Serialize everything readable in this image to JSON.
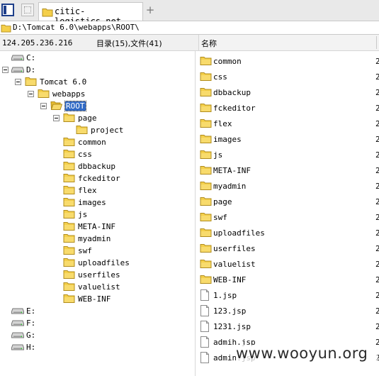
{
  "tabs": {
    "active_label": "citic-logistics.net",
    "new_tab": "+"
  },
  "path": "D:\\Tomcat 6.0\\webapps\\ROOT\\",
  "info": {
    "ip": "124.205.236.216",
    "counts": "目录(15),文件(41)"
  },
  "columns": {
    "name": "名称"
  },
  "tree": [
    {
      "name": "drive-c",
      "label": "C:",
      "level": 0,
      "icon": "drive",
      "expander": false
    },
    {
      "name": "drive-d",
      "label": "D:",
      "level": 0,
      "icon": "drive",
      "expander": true
    },
    {
      "name": "tomcat",
      "label": "Tomcat 6.0",
      "level": 1,
      "icon": "folder",
      "expander": true
    },
    {
      "name": "webapps",
      "label": "webapps",
      "level": 2,
      "icon": "folder",
      "expander": true
    },
    {
      "name": "root",
      "label": "ROOT",
      "level": 3,
      "icon": "folder-open",
      "expander": true,
      "selected": true
    },
    {
      "name": "page",
      "label": "page",
      "level": 4,
      "icon": "folder",
      "expander": true
    },
    {
      "name": "project",
      "label": "project",
      "level": 5,
      "icon": "folder",
      "expander": false
    },
    {
      "name": "common",
      "label": "common",
      "level": 4,
      "icon": "folder",
      "expander": false
    },
    {
      "name": "css",
      "label": "css",
      "level": 4,
      "icon": "folder",
      "expander": false
    },
    {
      "name": "dbbackup",
      "label": "dbbackup",
      "level": 4,
      "icon": "folder",
      "expander": false
    },
    {
      "name": "fckeditor",
      "label": "fckeditor",
      "level": 4,
      "icon": "folder",
      "expander": false
    },
    {
      "name": "flex",
      "label": "flex",
      "level": 4,
      "icon": "folder",
      "expander": false
    },
    {
      "name": "images",
      "label": "images",
      "level": 4,
      "icon": "folder",
      "expander": false
    },
    {
      "name": "js",
      "label": "js",
      "level": 4,
      "icon": "folder",
      "expander": false
    },
    {
      "name": "meta-inf",
      "label": "META-INF",
      "level": 4,
      "icon": "folder",
      "expander": false
    },
    {
      "name": "myadmin",
      "label": "myadmin",
      "level": 4,
      "icon": "folder",
      "expander": false
    },
    {
      "name": "swf",
      "label": "swf",
      "level": 4,
      "icon": "folder",
      "expander": false
    },
    {
      "name": "uploadfiles",
      "label": "uploadfiles",
      "level": 4,
      "icon": "folder",
      "expander": false
    },
    {
      "name": "userfiles",
      "label": "userfiles",
      "level": 4,
      "icon": "folder",
      "expander": false
    },
    {
      "name": "valuelist",
      "label": "valuelist",
      "level": 4,
      "icon": "folder",
      "expander": false
    },
    {
      "name": "web-inf",
      "label": "WEB-INF",
      "level": 4,
      "icon": "folder",
      "expander": false
    },
    {
      "name": "drive-e",
      "label": "E:",
      "level": 0,
      "icon": "drive",
      "expander": false
    },
    {
      "name": "drive-f",
      "label": "F:",
      "level": 0,
      "icon": "drive",
      "expander": false
    },
    {
      "name": "drive-g",
      "label": "G:",
      "level": 0,
      "icon": "drive",
      "expander": false
    },
    {
      "name": "drive-h",
      "label": "H:",
      "level": 0,
      "icon": "drive",
      "expander": false
    }
  ],
  "files": [
    {
      "label": "common",
      "icon": "folder",
      "trunc": "2"
    },
    {
      "label": "css",
      "icon": "folder",
      "trunc": "2"
    },
    {
      "label": "dbbackup",
      "icon": "folder",
      "trunc": "2"
    },
    {
      "label": "fckeditor",
      "icon": "folder",
      "trunc": "2"
    },
    {
      "label": "flex",
      "icon": "folder",
      "trunc": "2"
    },
    {
      "label": "images",
      "icon": "folder",
      "trunc": "2"
    },
    {
      "label": "js",
      "icon": "folder",
      "trunc": "2"
    },
    {
      "label": "META-INF",
      "icon": "folder",
      "trunc": "2"
    },
    {
      "label": "myadmin",
      "icon": "folder",
      "trunc": "2"
    },
    {
      "label": "page",
      "icon": "folder",
      "trunc": "2"
    },
    {
      "label": "swf",
      "icon": "folder",
      "trunc": "2"
    },
    {
      "label": "uploadfiles",
      "icon": "folder",
      "trunc": "2"
    },
    {
      "label": "userfiles",
      "icon": "folder",
      "trunc": "2"
    },
    {
      "label": "valuelist",
      "icon": "folder",
      "trunc": "2"
    },
    {
      "label": "WEB-INF",
      "icon": "folder",
      "trunc": "2"
    },
    {
      "label": "1.jsp",
      "icon": "file",
      "trunc": "2"
    },
    {
      "label": "123.jsp",
      "icon": "file",
      "trunc": "2"
    },
    {
      "label": "1231.jsp",
      "icon": "file",
      "trunc": "2"
    },
    {
      "label": "admih.jsp",
      "icon": "file",
      "trunc": "2"
    },
    {
      "label": "admin.jsp",
      "icon": "file",
      "trunc": "2"
    }
  ],
  "watermark": "www.wooyun.org",
  "colors": {
    "folder": "#f4cf4a",
    "folder_edge": "#b08c1e",
    "selection": "#316ac5"
  }
}
